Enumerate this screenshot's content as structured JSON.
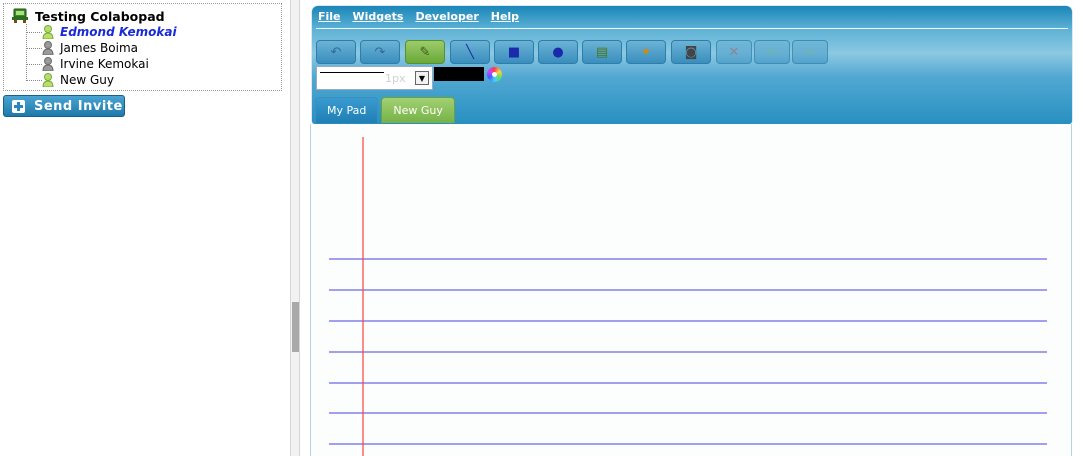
{
  "roster": {
    "title": "Testing Colabopad",
    "members": [
      {
        "name": "Edmond Kemokai",
        "status": "online",
        "current_user": true
      },
      {
        "name": "James Boima",
        "status": "offline",
        "current_user": false
      },
      {
        "name": "Irvine Kemokai",
        "status": "offline",
        "current_user": false
      },
      {
        "name": "New Guy",
        "status": "online",
        "current_user": false
      }
    ]
  },
  "send_invite_label": "Send Invite",
  "menu": [
    "File",
    "Widgets",
    "Developer",
    "Help"
  ],
  "tools": [
    {
      "name": "undo",
      "icon": "undo-icon",
      "glyph": "↶",
      "state": "normal"
    },
    {
      "name": "redo",
      "icon": "redo-icon",
      "glyph": "↷",
      "state": "normal"
    },
    {
      "name": "pencil",
      "icon": "pencil-icon",
      "glyph": "✎",
      "state": "selected"
    },
    {
      "name": "line",
      "icon": "line-icon",
      "glyph": "╲",
      "state": "normal"
    },
    {
      "name": "rectangle",
      "icon": "rectangle-icon",
      "glyph": "■",
      "state": "normal"
    },
    {
      "name": "ellipse",
      "icon": "ellipse-icon",
      "glyph": "●",
      "state": "normal"
    },
    {
      "name": "text",
      "icon": "text-document-icon",
      "glyph": "▤",
      "state": "normal"
    },
    {
      "name": "clear",
      "icon": "broom-icon",
      "glyph": "✦",
      "state": "normal"
    },
    {
      "name": "snapshot",
      "icon": "camera-icon",
      "glyph": "◙",
      "state": "normal"
    },
    {
      "name": "delete",
      "icon": "delete-x-icon",
      "glyph": "✕",
      "state": "disabled"
    },
    {
      "name": "back",
      "icon": "arrow-left-icon",
      "glyph": "⇦",
      "state": "disabled"
    },
    {
      "name": "forward",
      "icon": "arrow-right-icon",
      "glyph": "⇨",
      "state": "disabled"
    }
  ],
  "line_width_label": "1px",
  "stroke_color": "#000000",
  "tabs": [
    {
      "label": "My Pad",
      "active": false
    },
    {
      "label": "New Guy",
      "active": true
    }
  ],
  "colors": {
    "margin_line": "#ff4040",
    "rule_line": "#4444dd",
    "selected_green": "#7ab64a",
    "toolbar_blue": "#2790c1"
  }
}
